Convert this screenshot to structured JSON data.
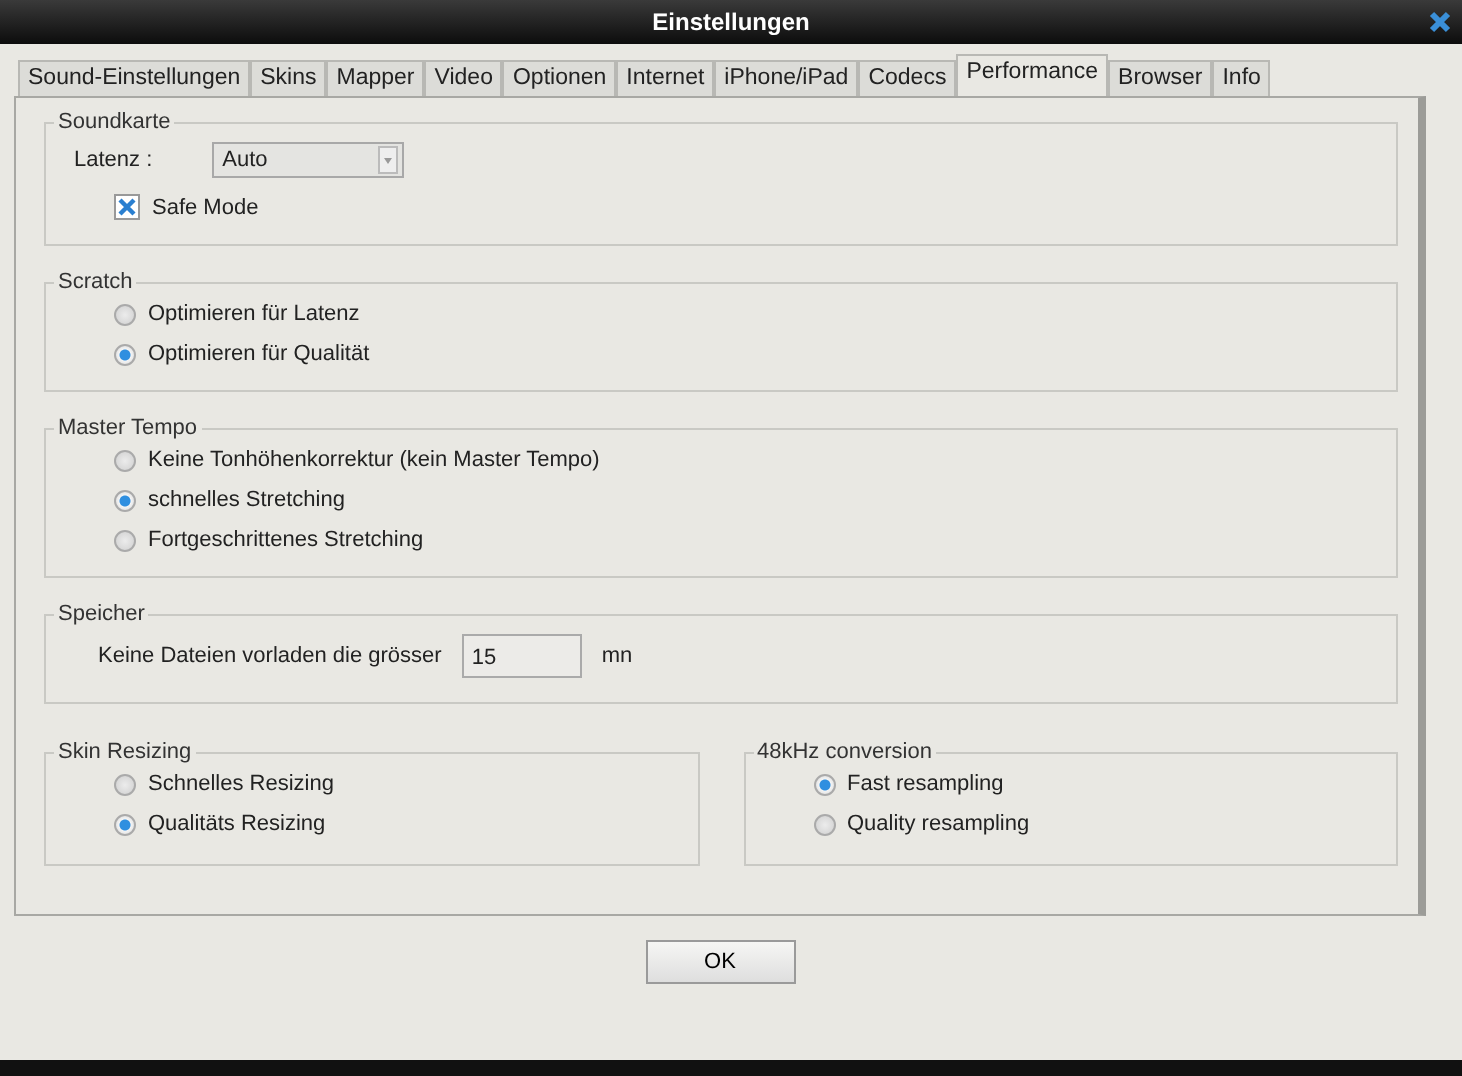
{
  "window": {
    "title": "Einstellungen"
  },
  "tabs": [
    {
      "label": "Sound-Einstellungen",
      "selected": false
    },
    {
      "label": "Skins",
      "selected": false
    },
    {
      "label": "Mapper",
      "selected": false
    },
    {
      "label": "Video",
      "selected": false
    },
    {
      "label": "Optionen",
      "selected": false
    },
    {
      "label": "Internet",
      "selected": false
    },
    {
      "label": "iPhone/iPad",
      "selected": false
    },
    {
      "label": "Codecs",
      "selected": false
    },
    {
      "label": "Performance",
      "selected": true
    },
    {
      "label": "Browser",
      "selected": false
    },
    {
      "label": "Info",
      "selected": false
    }
  ],
  "sections": [
    {
      "title": "Soundkarte",
      "controls": [
        {
          "kind": "select",
          "label": "Latenz :",
          "value": "Auto"
        },
        {
          "kind": "checkbox",
          "label": "Safe Mode",
          "checked": true
        }
      ]
    },
    {
      "title": "Scratch",
      "controls": [
        {
          "kind": "radio",
          "label": "Optimieren für Latenz",
          "selected": false
        },
        {
          "kind": "radio",
          "label": "Optimieren für Qualität",
          "selected": true
        }
      ]
    },
    {
      "title": "Master Tempo",
      "controls": [
        {
          "kind": "radio",
          "label": "Keine Tonhöhenkorrektur (kein Master Tempo)",
          "selected": false
        },
        {
          "kind": "radio",
          "label": "schnelles Stretching",
          "selected": true
        },
        {
          "kind": "radio",
          "label": "Fortgeschrittenes Stretching",
          "selected": false
        }
      ]
    },
    {
      "title": "Speicher",
      "controls": [
        {
          "kind": "number",
          "label": "Keine Dateien vorladen die grösser",
          "value": "15",
          "unit": "mn"
        }
      ]
    }
  ],
  "bottom_sections": [
    {
      "title": "Skin Resizing",
      "controls": [
        {
          "kind": "radio",
          "label": "Schnelles Resizing",
          "selected": false
        },
        {
          "kind": "radio",
          "label": "Qualitäts Resizing",
          "selected": true
        }
      ]
    },
    {
      "title": "48kHz conversion",
      "controls": [
        {
          "kind": "radio",
          "label": "Fast resampling",
          "selected": true
        },
        {
          "kind": "radio",
          "label": "Quality resampling",
          "selected": false
        }
      ]
    }
  ],
  "ok_button": "OK"
}
